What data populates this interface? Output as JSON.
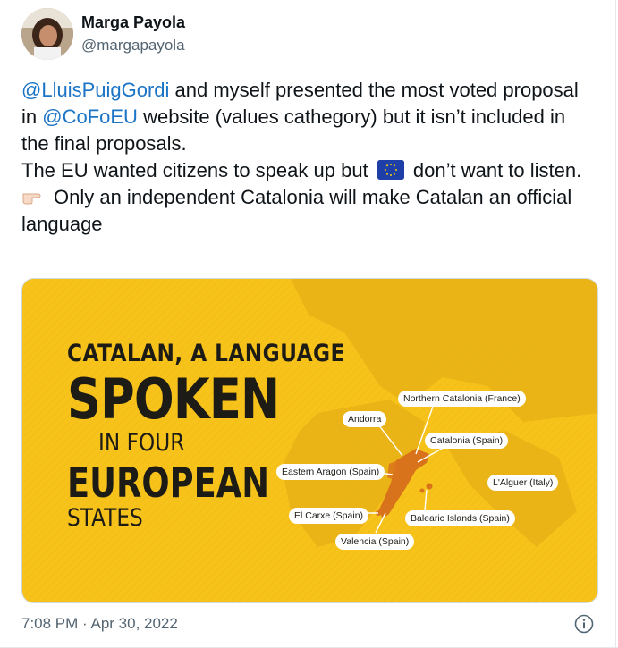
{
  "author": {
    "name": "Marga Payola",
    "handle": "@margapayola"
  },
  "tweet": {
    "mention1": "@LluisPuigGordi",
    "text1": " and myself presented the most voted proposal in ",
    "mention2": "@CoFoEU",
    "text2": " website (values cathegory) but it isn’t included in the final proposals.",
    "line2a": "The EU wanted citizens to speak up but ",
    "line2b": " don’t want to listen.",
    "line3": "Only an independent Catalonia will make Catalan an official language",
    "flag_icon": "eu-flag-icon",
    "hand_icon": "pointing-hand-icon"
  },
  "image": {
    "background_color": "#f7c31b",
    "line1": "CATALAN, A LANGUAGE",
    "line2": "SPOKEN",
    "line3": "IN FOUR",
    "line4": "EUROPEAN",
    "line5": "STATES",
    "labels": [
      "Northern Catalonia (France)",
      "Andorra",
      "Catalonia (Spain)",
      "Eastern Aragon (Spain)",
      "L'Alguer (Italy)",
      "El Carxe (Spain)",
      "Balearic Islands (Spain)",
      "Valencia (Spain)"
    ]
  },
  "meta": {
    "timestamp": "7:08 PM · Apr 30, 2022",
    "info_icon": "info-icon"
  },
  "colors": {
    "link": "#1b74c5",
    "secondary": "#536471",
    "region": "#d9731b"
  }
}
